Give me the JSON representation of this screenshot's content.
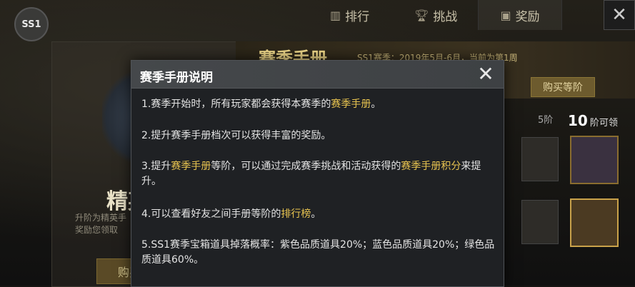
{
  "topbar": {
    "season_badge": "SS1",
    "tabs": [
      {
        "label": "排行",
        "icon": "bar-chart-icon"
      },
      {
        "label": "挑战",
        "icon": "trophy-icon"
      },
      {
        "label": "奖励",
        "icon": "gift-icon"
      }
    ],
    "close_icon": "close-icon"
  },
  "background": {
    "left_card": {
      "title": "精英",
      "desc": "升阶为精英手\n奖励您领取",
      "buy_label": "购买"
    },
    "banner": {
      "logo": "赛季手册",
      "info": "SS1赛季：2019年5月-6月，当前为第1周"
    },
    "buy_levels_label": "购买等阶",
    "tier5_label": "5阶",
    "tier10_num": "10",
    "tier10_label": "阶可领"
  },
  "modal": {
    "title": "赛季手册说明",
    "items": {
      "i1_a": "1.赛季开始时，所有玩家都会获得本赛季的",
      "i1_hl": "赛季手册",
      "i1_b": "。",
      "i2": "2.提升赛季手册档次可以获得丰富的奖励。",
      "i3_a": "3.提升",
      "i3_hl1": "赛季手册",
      "i3_b": "等阶，可以通过完成赛季挑战和活动获得的",
      "i3_hl2": "赛季手册积分",
      "i3_c": "来提升。",
      "i4_a": "4.可以查看好友之间手册等阶的",
      "i4_hl": "排行榜",
      "i4_b": "。",
      "i5": "5.SS1赛季宝箱道具掉落概率：紫色品质道具20%；蓝色品质道具20%；绿色品质道具60%。"
    }
  },
  "colors": {
    "highlight": "#e8c450",
    "modal_bg": "#1f2124",
    "text": "#e4e4e4"
  }
}
